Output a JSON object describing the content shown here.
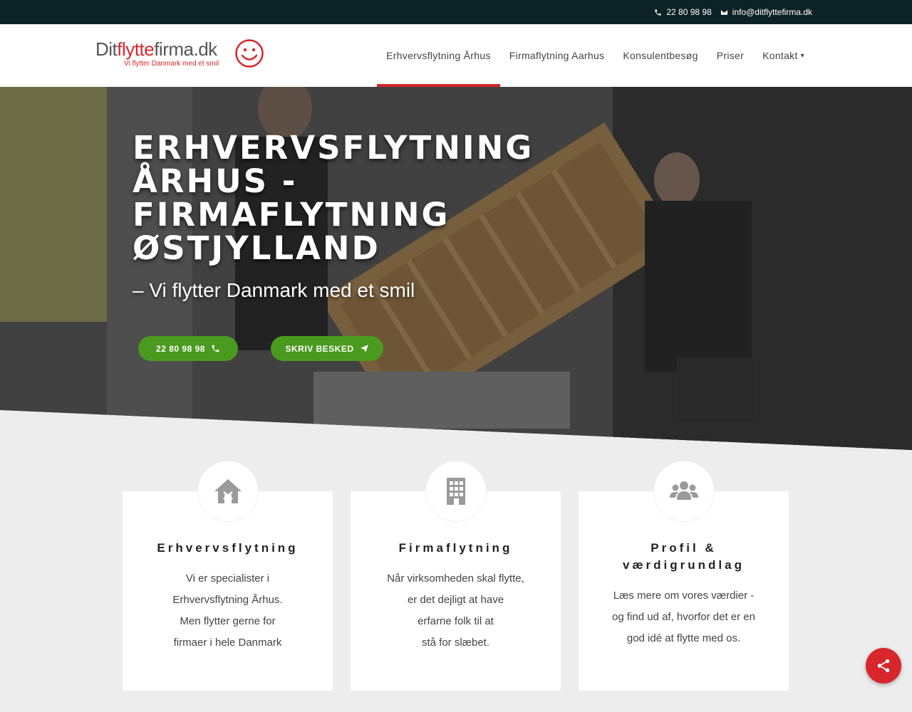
{
  "topbar": {
    "phone": "22 80 98 98",
    "email": "info@ditflyttefirma.dk"
  },
  "logo": {
    "part1": "Dit",
    "part2": "flytte",
    "part3": "firma.dk",
    "tagline": "Vi flytter Danmark med et smil"
  },
  "nav": {
    "items": [
      {
        "label": "Erhvervsflytning Århus",
        "active": true
      },
      {
        "label": "Firmaflytning Aarhus"
      },
      {
        "label": "Konsulentbesøg"
      },
      {
        "label": "Priser"
      },
      {
        "label": "Kontakt"
      }
    ]
  },
  "hero": {
    "title": "ERHVERVSFLYTNING ÅRHUS - FIRMAFLYTNING ØSTJYLLAND",
    "subtitle": "– Vi flytter Danmark med et smil",
    "buttons": {
      "phone_label": "22 80 98 98",
      "message_label": "SKRIV BESKED"
    }
  },
  "cards": [
    {
      "icon": "home-icon",
      "title": "Erhvervsflytning",
      "lines": [
        "Vi er specialister i",
        "Erhvervsflytning Århus.",
        "Men flytter gerne for",
        "firmaer i hele Danmark"
      ]
    },
    {
      "icon": "building-icon",
      "title": "Firmaflytning",
      "lines": [
        "Når virksomheden skal flytte,",
        "er det dejligt at have",
        "erfarne folk til at",
        "stå for slæbet."
      ]
    },
    {
      "icon": "users-icon",
      "title_line1": "Profil &",
      "title_line2": "værdigrundlag",
      "lines": [
        "Læs mere om vores værdier -",
        "og find ud af, hvorfor det er en",
        "god idé at flytte med os."
      ]
    }
  ],
  "colors": {
    "brand_red": "#d7262c",
    "cta_green": "#4a9a1f",
    "topbar_bg": "#0d2226"
  }
}
